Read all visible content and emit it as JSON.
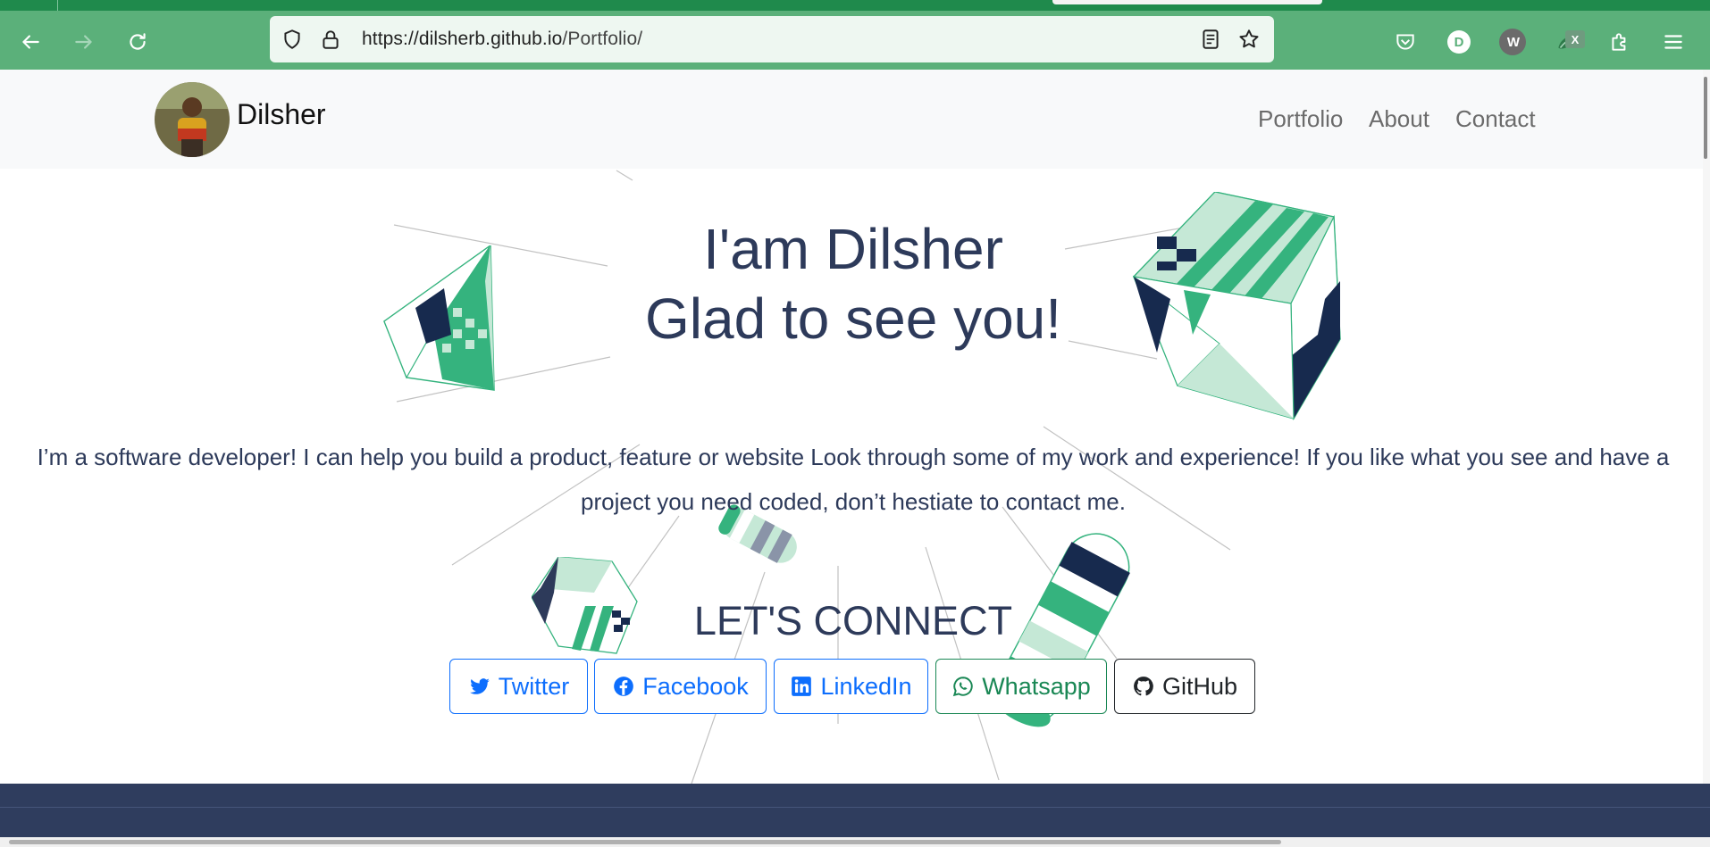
{
  "browser": {
    "url_host": "https://dilsherb.github.io",
    "url_path": "/Portfolio/",
    "profile_initial": "D",
    "extension_badge": "X",
    "extension_avatar": "W"
  },
  "site": {
    "brand": "Dilsher",
    "nav": [
      "Portfolio",
      "About",
      "Contact"
    ]
  },
  "hero": {
    "line1": "I'am Dilsher",
    "line2": "Glad to see you!",
    "intro": "I’m a software developer! I can help you build a product, feature or website Look through some of my work and experience! If you like what you see and have a project you need coded, don’t hestiate to contact me.",
    "connect_title": "LET'S CONNECT"
  },
  "social": [
    {
      "label": "Twitter",
      "icon": "twitter-icon",
      "color": "#0d6efd"
    },
    {
      "label": "Facebook",
      "icon": "facebook-icon",
      "color": "#0d6efd"
    },
    {
      "label": "LinkedIn",
      "icon": "linkedin-icon",
      "color": "#0d6efd"
    },
    {
      "label": "Whatsapp",
      "icon": "whatsapp-icon",
      "color": "#198754"
    },
    {
      "label": "GitHub",
      "icon": "github-icon",
      "color": "#212529"
    }
  ],
  "colors": {
    "chrome": "#5bb07a",
    "text": "#2d3a5a",
    "accent_green": "#35b37e",
    "navy": "#172a4e"
  }
}
